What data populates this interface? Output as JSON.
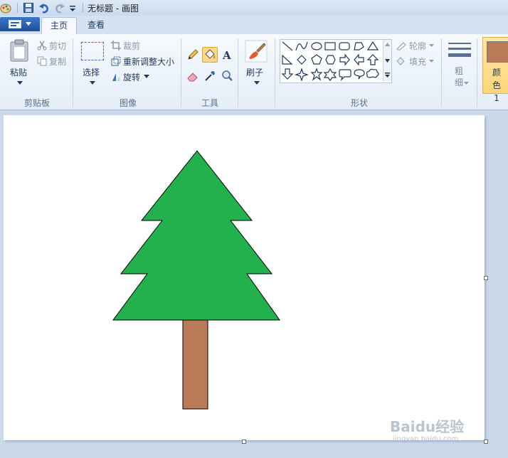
{
  "window": {
    "title": "无标题 - 画图"
  },
  "quick_access": {
    "icons": [
      "paint-app-icon",
      "save-icon",
      "undo-icon",
      "redo-icon",
      "customize-dropdown-icon"
    ]
  },
  "tabs": [
    {
      "label": "主页",
      "active": true
    },
    {
      "label": "查看",
      "active": false
    }
  ],
  "ribbon": {
    "clipboard": {
      "paste": "粘贴",
      "cut": "剪切",
      "copy": "复制",
      "group": "剪贴板"
    },
    "image": {
      "select": "选择",
      "crop": "裁剪",
      "resize": "重新调整大小",
      "rotate": "旋转",
      "group": "图像"
    },
    "tools": {
      "group": "工具",
      "active_tool": "fill-icon"
    },
    "brushes": {
      "label": "刷子"
    },
    "shapes": {
      "group": "形状",
      "outline": "轮廓",
      "fill": "填充"
    },
    "size": {
      "label": "粗细"
    },
    "colors": {
      "color1_label": "颜色 1",
      "color1": "#b97a57"
    }
  },
  "drawing": {
    "tree_color": "#22b14c",
    "trunk_color": "#b97a57",
    "outline_color": "#000000"
  },
  "watermark": {
    "text": "Baidu经验",
    "sub": "jingyan.baidu.com"
  }
}
